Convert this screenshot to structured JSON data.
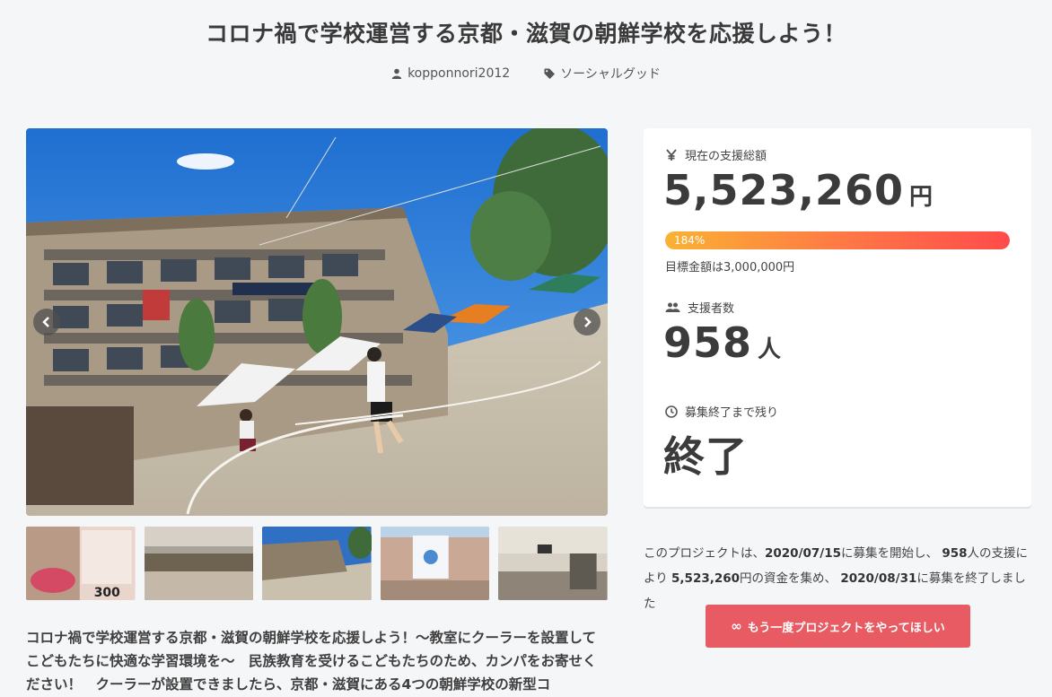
{
  "header": {
    "title": "コロナ禍で学校運営する京都・滋賀の朝鮮学校を応援しよう！",
    "author": "kopponnori2012",
    "category": "ソーシャルグッド"
  },
  "stats": {
    "total_label": "現在の支援総額",
    "total_value": "5,523,260",
    "total_unit": "円",
    "progress_label": "184%",
    "progress_fraction": 1.0,
    "goal_text": "目標金額は3,000,000円",
    "supporters_label": "支援者数",
    "supporters_value": "958",
    "supporters_unit": "人",
    "remaining_label": "募集終了まで残り",
    "remaining_value": "終了"
  },
  "summary": {
    "p1": "このプロジェクトは、",
    "start_date": "2020/07/15",
    "p2": "に募集を開始し、 ",
    "supporters": "958",
    "p3": "人の支援により ",
    "amount": "5,523,260",
    "p4": "円の資金を集め、 ",
    "end_date": "2020/08/31",
    "p5": "に募集を終了しました"
  },
  "cta_label": "もう一度プロジェクトをやってほしい",
  "thumb4_text": "300",
  "description": "コロナ禍で学校運営する京都・滋賀の朝鮮学校を応援しよう！～教室にクーラーを設置してこどもたちに快適な学習環境を～　民族教育を受けるこどもたちのため、カンパをお寄せください！　クーラーが設置できましたら、京都・滋賀にある4つの朝鮮学校の新型コ",
  "colors": {
    "accent": "#e85b63",
    "progress_start": "#f9b233",
    "progress_end": "#ff4b4b"
  },
  "icons": {
    "author": "user-icon",
    "category": "tag-icon",
    "total": "yen-icon",
    "supporters": "users-icon",
    "remaining": "clock-icon",
    "cta": "infinity-icon"
  }
}
